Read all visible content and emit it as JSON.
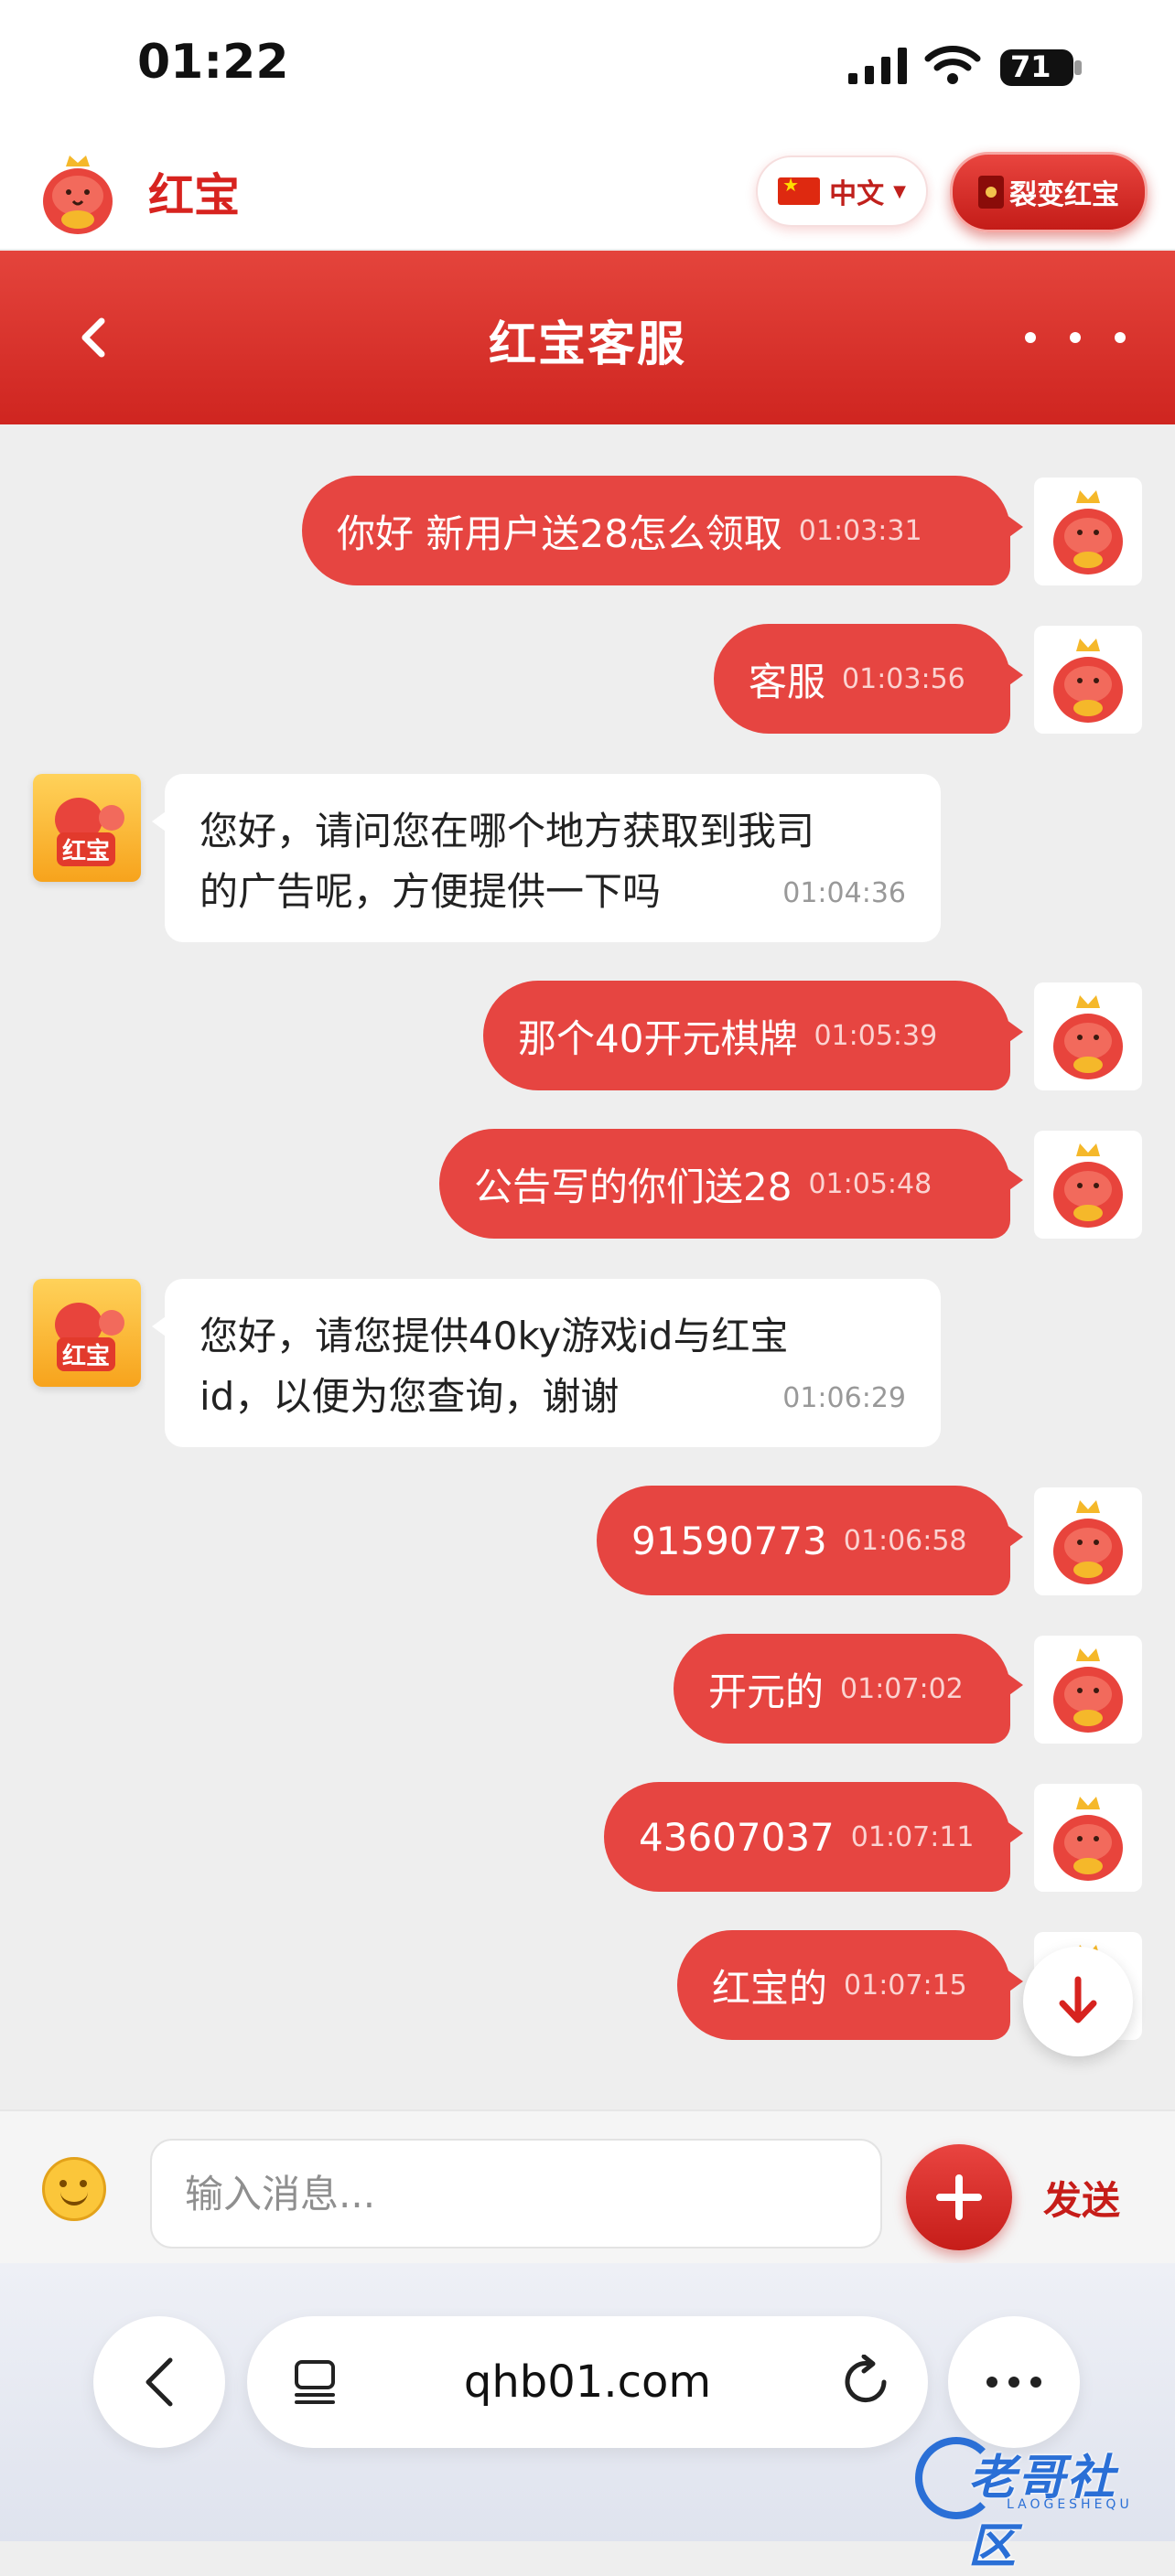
{
  "status_bar": {
    "time": "01:22",
    "battery": "71"
  },
  "app_header": {
    "brand_name": "红宝",
    "language_label": "中文",
    "fission_button_label": "裂变红宝"
  },
  "chat_header": {
    "title": "红宝客服"
  },
  "messages": [
    {
      "side": "out",
      "text": "你好 新用户送28怎么领取",
      "time": "01:03:31"
    },
    {
      "side": "out",
      "text": "客服",
      "time": "01:03:56"
    },
    {
      "side": "in",
      "lines": [
        "您好，请问您在哪个地方获取到我司",
        "的广告呢，方便提供一下吗"
      ],
      "time": "01:04:36"
    },
    {
      "side": "out",
      "text": "那个40开元棋牌",
      "time": "01:05:39"
    },
    {
      "side": "out",
      "text": "公告写的你们送28",
      "time": "01:05:48"
    },
    {
      "side": "in",
      "lines": [
        "您好，请您提供40ky游戏id与红宝",
        "id，以便为您查询，谢谢"
      ],
      "time": "01:06:29"
    },
    {
      "side": "out",
      "text": "91590773",
      "time": "01:06:58"
    },
    {
      "side": "out",
      "text": "开元的",
      "time": "01:07:02"
    },
    {
      "side": "out",
      "text": "43607037",
      "time": "01:07:11"
    },
    {
      "side": "out",
      "text": "红宝的",
      "time": "01:07:15"
    }
  ],
  "avatar_badge": "红宝",
  "input_bar": {
    "placeholder": "输入消息...",
    "send_label": "发送"
  },
  "browser": {
    "url": "qhb01.com"
  },
  "watermark": {
    "text": "老哥社区",
    "sub": "LAOGESHEQU"
  },
  "colors": {
    "accent": "#e64541",
    "header_red": "#d7231f"
  }
}
